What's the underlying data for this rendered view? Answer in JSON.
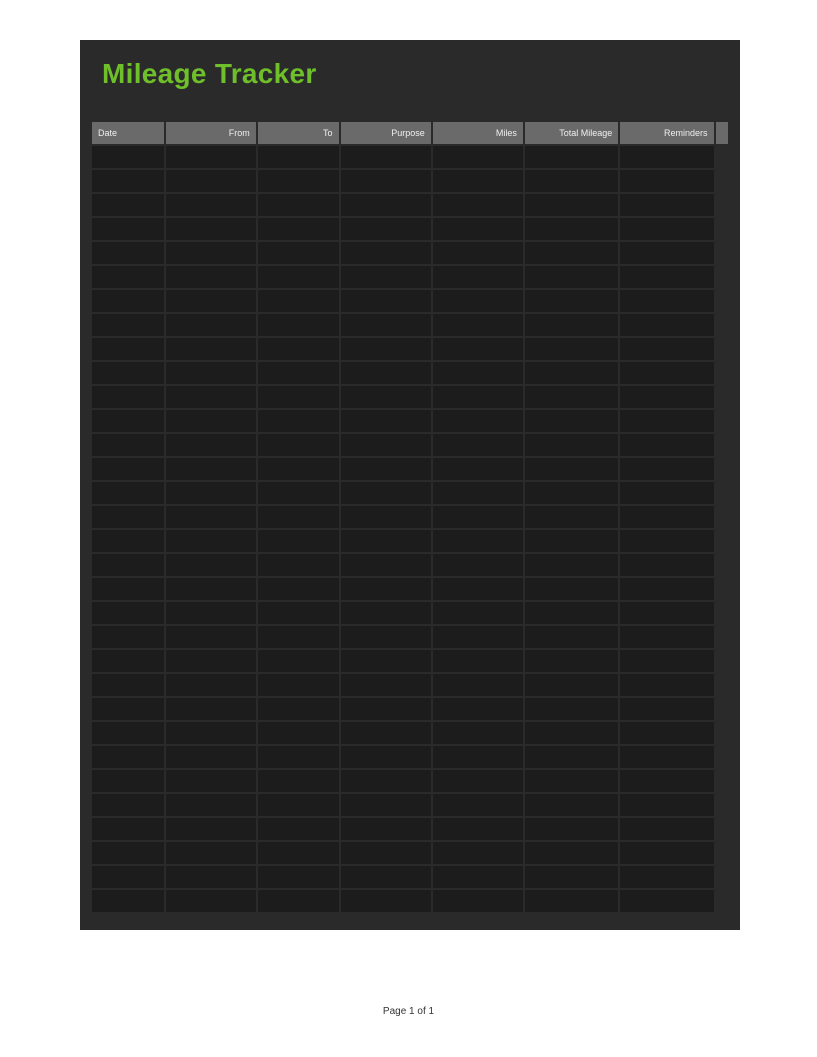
{
  "title": "Mileage Tracker",
  "columns": [
    {
      "label": "Date",
      "align": "left"
    },
    {
      "label": "From",
      "align": "right"
    },
    {
      "label": "To",
      "align": "right"
    },
    {
      "label": "Purpose",
      "align": "right"
    },
    {
      "label": "Miles",
      "align": "right"
    },
    {
      "label": "Total Mileage",
      "align": "right"
    },
    {
      "label": "Reminders",
      "align": "right"
    }
  ],
  "row_count": 32,
  "rows": [],
  "footer": "Page 1 of 1",
  "colors": {
    "accent": "#6fbf2a",
    "sheet_bg": "#2a2a2a",
    "cell_bg": "#1c1c1c",
    "header_bg": "#6a6a6a"
  }
}
